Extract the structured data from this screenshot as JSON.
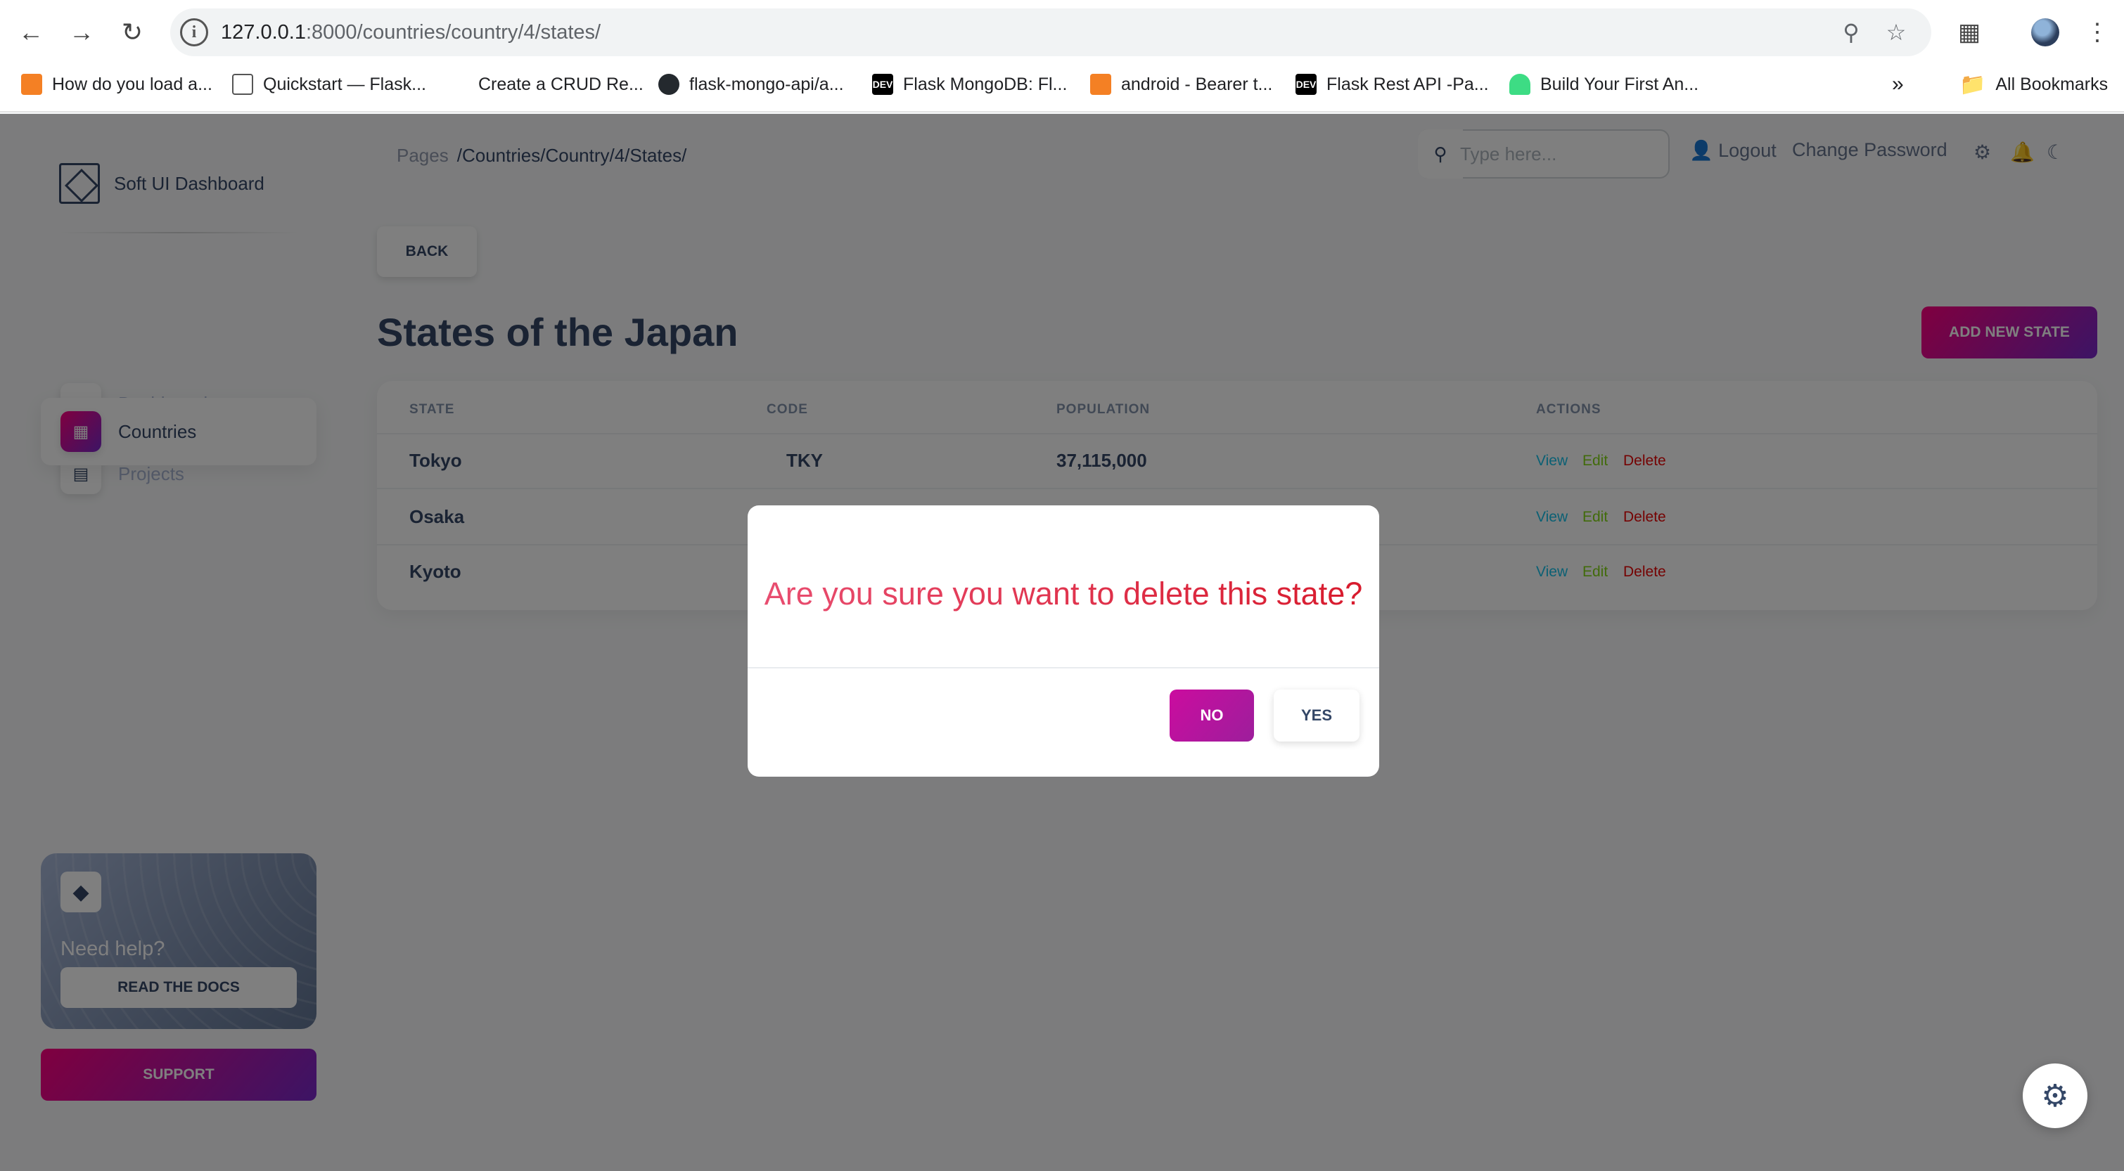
{
  "browser": {
    "url_host": "127.0.0.1",
    "url_rest": ":8000/countries/country/4/states/",
    "bookmarks": [
      "How do you load a...",
      "Quickstart — Flask...",
      "Create a CRUD Re...",
      "flask-mongo-api/a...",
      "Flask MongoDB: Fl...",
      "android - Bearer t...",
      "Flask Rest API -Pa...",
      "Build Your First An..."
    ],
    "all_bookmarks": "All Bookmarks"
  },
  "sidebar": {
    "brand": "Soft UI Dashboard",
    "items": [
      {
        "label": "Dashboard"
      },
      {
        "label": "Projects"
      },
      {
        "label": "Countries"
      }
    ],
    "help_title": "Need help?",
    "help_button": "READ THE DOCS",
    "support_button": "SUPPORT"
  },
  "header": {
    "breadcrumb_root": "Pages",
    "breadcrumb_path": "/Countries/Country/4/States/",
    "search_placeholder": "Type here...",
    "logout": "Logout",
    "change_password": "Change Password"
  },
  "main": {
    "back_button": "BACK",
    "title": "States of the Japan",
    "add_button": "ADD NEW STATE",
    "columns": [
      "STATE",
      "CODE",
      "POPULATION",
      "ACTIONS"
    ],
    "rows": [
      {
        "state": "Tokyo",
        "code": "TKY",
        "population": "37,115,000"
      },
      {
        "state": "Osaka",
        "code": "",
        "population": ""
      },
      {
        "state": "Kyoto",
        "code": "",
        "population": ""
      }
    ],
    "actions": {
      "view": "View",
      "edit": "Edit",
      "delete": "Delete"
    }
  },
  "modal": {
    "message": "Are you sure you want to delete this state?",
    "no": "NO",
    "yes": "YES"
  }
}
